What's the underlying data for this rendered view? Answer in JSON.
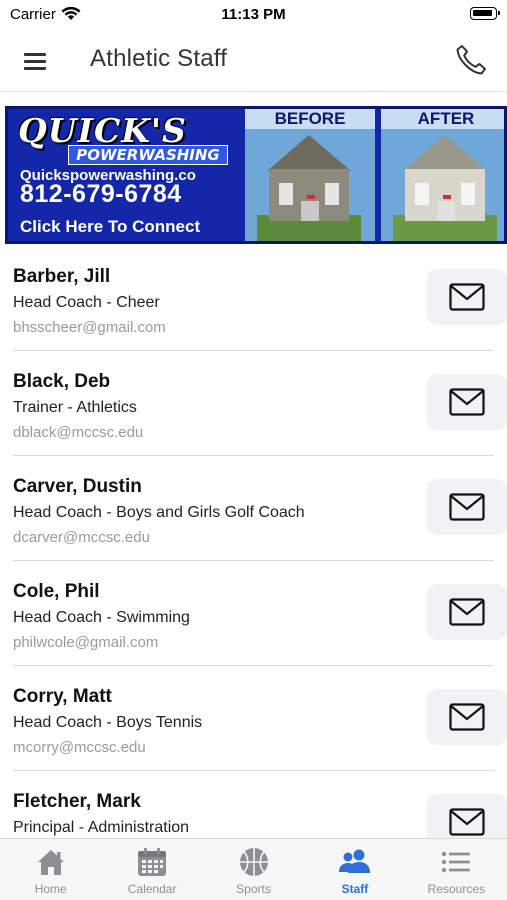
{
  "status_bar": {
    "carrier": "Carrier",
    "time": "11:13 PM",
    "wifi_icon": "wifi-icon",
    "battery_icon": "battery-icon"
  },
  "header": {
    "title": "Athletic Staff",
    "menu_icon": "hamburger-menu-icon",
    "call_icon": "phone-icon"
  },
  "ad": {
    "brand": "QUICK'S",
    "subtitle": "POWERWASHING",
    "url": "Quickspowerwashing.co",
    "phone": "812-679-6784",
    "cta": "Click Here To Connect",
    "before_label": "BEFORE",
    "after_label": "AFTER",
    "background_color": "#1427a8"
  },
  "staff": [
    {
      "name": "Barber, Jill",
      "role": "Head Coach - Cheer",
      "email": "bhsscheer@gmail.com"
    },
    {
      "name": "Black, Deb",
      "role": "Trainer - Athletics",
      "email": "dblack@mccsc.edu"
    },
    {
      "name": "Carver, Dustin",
      "role": "Head Coach - Boys and Girls Golf Coach",
      "email": "dcarver@mccsc.edu"
    },
    {
      "name": "Cole, Phil",
      "role": "Head Coach - Swimming",
      "email": "philwcole@gmail.com"
    },
    {
      "name": "Corry, Matt",
      "role": "Head Coach - Boys Tennis",
      "email": "mcorry@mccsc.edu"
    },
    {
      "name": "Fletcher, Mark",
      "role": "Principal - Administration",
      "email": ""
    }
  ],
  "tabbar": {
    "tabs": [
      {
        "label": "Home",
        "icon": "home-icon",
        "active": false
      },
      {
        "label": "Calendar",
        "icon": "calendar-icon",
        "active": false
      },
      {
        "label": "Sports",
        "icon": "basketball-icon",
        "active": false
      },
      {
        "label": "Staff",
        "icon": "people-icon",
        "active": true
      },
      {
        "label": "Resources",
        "icon": "list-icon",
        "active": false
      }
    ],
    "active_color": "#2f6fd6",
    "inactive_color": "#8e8e93"
  }
}
